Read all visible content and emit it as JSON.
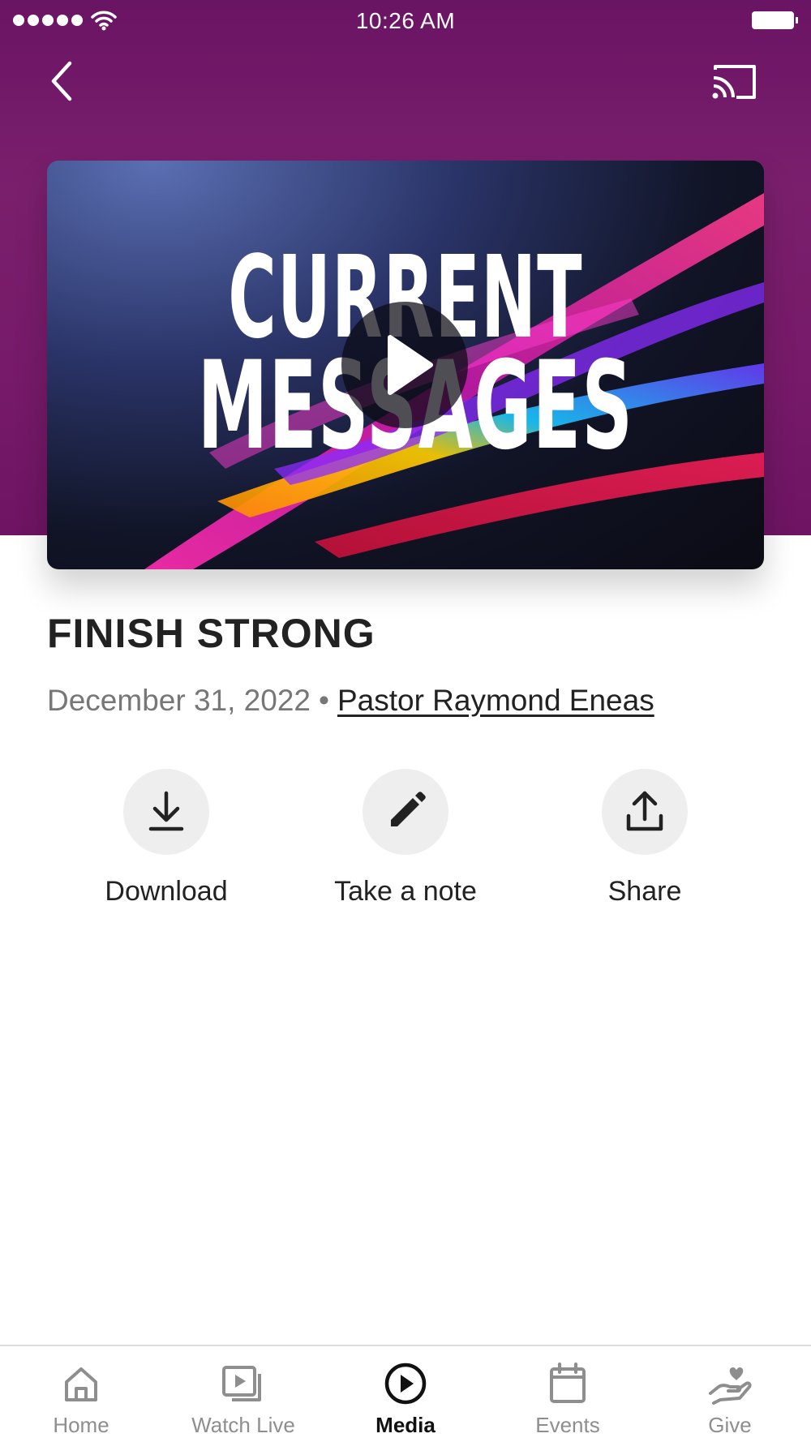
{
  "status_bar": {
    "time": "10:26 AM"
  },
  "media": {
    "artwork_line1": "CURRENT",
    "artwork_line2": "MESSAGES",
    "title": "FINISH STRONG",
    "date": "December 31, 2022",
    "separator": "•",
    "speaker": "Pastor Raymond Eneas"
  },
  "actions": [
    {
      "label": "Download",
      "icon": "download-icon"
    },
    {
      "label": "Take a note",
      "icon": "pencil-icon"
    },
    {
      "label": "Share",
      "icon": "share-icon"
    }
  ],
  "tab_bar": {
    "tabs": [
      {
        "label": "Home",
        "icon": "home-icon",
        "active": false
      },
      {
        "label": "Watch Live",
        "icon": "video-icon",
        "active": false
      },
      {
        "label": "Media",
        "icon": "play-circle-icon",
        "active": true
      },
      {
        "label": "Events",
        "icon": "calendar-icon",
        "active": false
      },
      {
        "label": "Give",
        "icon": "giving-hand-icon",
        "active": false
      }
    ]
  },
  "colors": {
    "header_purple": "#761a69",
    "tab_active": "#111111",
    "tab_inactive": "#8e8e8e"
  }
}
